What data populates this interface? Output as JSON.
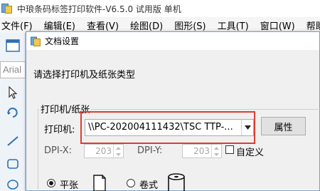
{
  "app": {
    "title": "中琅条码标签打印软件-V6.5.0 试用版 单机"
  },
  "menu": {
    "items": [
      "文件(F)",
      "编辑(E)",
      "查看(V)",
      "绘图(D)",
      "图形(S)",
      "工具(T)",
      "窗口(W)",
      "帮助"
    ]
  },
  "toolbar": {
    "font_combo_value": "Arial",
    "tools": [
      "document-icon",
      "select-arrow-icon",
      "rotate-icon",
      "line-icon",
      "rounded-rect-icon",
      "ellipse-icon"
    ]
  },
  "dialog": {
    "title": "文档设置",
    "instruction": "请选择打印机及纸张类型",
    "group_label": "打印机/纸张",
    "printer_label": "打印机:",
    "printer_value": "\\\\PC-202004111432\\TSC TTP-...",
    "properties_button": "属性",
    "dpi_x_label": "DPI-X:",
    "dpi_x_value": "203",
    "dpi_y_label": "DPI-Y:",
    "dpi_y_value": "203",
    "custom_label": "自定义",
    "custom_checked": false,
    "paper_sheet_label": "平张",
    "paper_roll_label": "卷式",
    "paper_type_selected": "平张",
    "highlight_color": "#e03c31"
  }
}
